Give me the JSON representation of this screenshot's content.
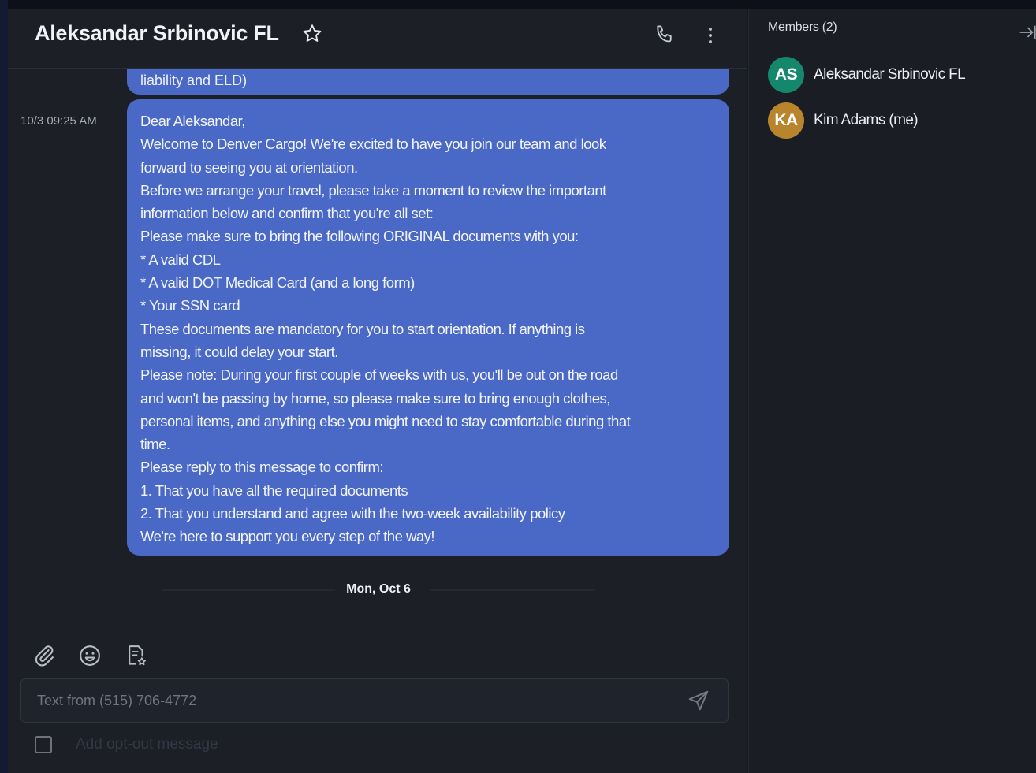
{
  "chat": {
    "title": "Aleksandar Srbinovic FL",
    "previous_message_tail": "liability and ELD)",
    "timestamp": "10/3 09:25 AM",
    "message_lines": [
      "Dear Aleksandar,",
      "Welcome to Denver Cargo! We're excited to have you join our team and look",
      "forward to seeing you at orientation.",
      "Before we arrange your travel, please take a moment to review the important",
      "information below and confirm that you're all set:",
      "Please make sure to bring the following ORIGINAL documents with you:",
      "* A valid CDL",
      "* A valid DOT Medical Card (and a long form)",
      "* Your SSN card",
      "These documents are mandatory for you to start orientation. If anything is",
      "missing, it could delay your start.",
      "Please note: During your first couple of weeks with us, you'll be out on the road",
      "and won't be passing by home, so please make sure to bring enough clothes,",
      "personal items, and anything else you might need to stay comfortable during that",
      "time.",
      "Please reply to this message to confirm:",
      "1. That you have all the required documents",
      "2. That you understand and agree with the two-week availability policy",
      "We're here to support you every step of the way!"
    ],
    "date_separator": "Mon, Oct 6",
    "composer_placeholder": "Text from (515) 706-4772",
    "optout_label": "Add opt-out message"
  },
  "members": {
    "title": "Members (2)",
    "list": [
      {
        "initials": "AS",
        "name": "Aleksandar Srbinovic FL",
        "color": "#14876c"
      },
      {
        "initials": "KA",
        "name": "Kim Adams (me)",
        "color": "#b8842c"
      }
    ]
  },
  "icons": [
    "star-icon",
    "phone-icon",
    "more-vertical-icon",
    "attachment-icon",
    "emoji-icon",
    "template-icon",
    "send-icon",
    "collapse-panel-icon"
  ],
  "colors": {
    "bubble": "#4a69c6",
    "background": "#1c1f26"
  }
}
